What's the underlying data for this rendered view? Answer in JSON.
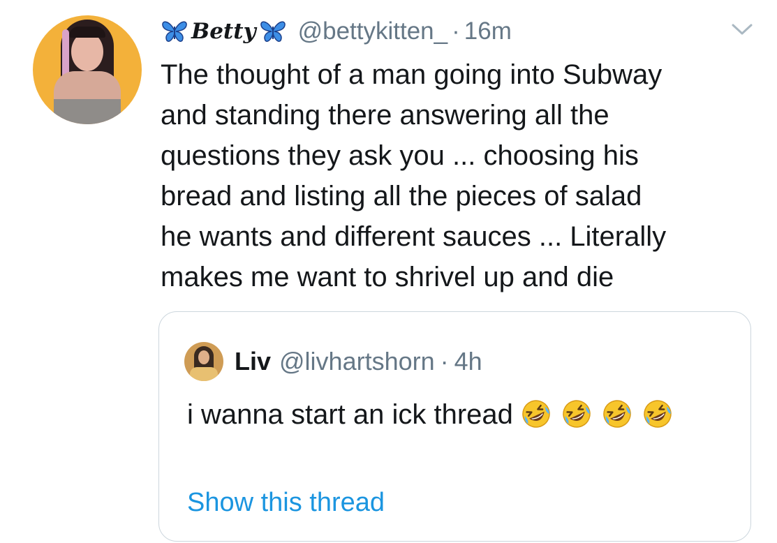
{
  "tweet": {
    "display_name": "Betty",
    "handle": "@bettykitten_",
    "separator": "·",
    "time": "16m",
    "lines": [
      "The thought of a man going into Subway",
      "and standing there answering all the",
      "questions they ask you ... choosing his",
      "bread and listing all the pieces of salad",
      "he wants and different sauces ... Literally",
      "makes me want to shrivel up and die"
    ]
  },
  "quoted": {
    "display_name": "Liv",
    "handle": "@livhartshorn",
    "separator": "·",
    "time": "4h",
    "text": "i wanna start an ick thread",
    "emoji": "rolling-on-floor-laughing",
    "emoji_count": 4,
    "show_thread": "Show this thread"
  },
  "colors": {
    "text": "#14171a",
    "secondary": "#657786",
    "link": "#1b95e0",
    "border": "#ccd6dd",
    "butterfly": "#3d8ee6",
    "avatar_bg": "#f3b13a"
  }
}
